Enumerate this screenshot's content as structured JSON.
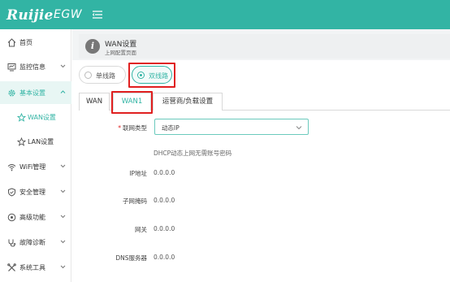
{
  "brand": {
    "logo_text": "Ruijie",
    "product": "EGW"
  },
  "sidebar": {
    "items": [
      {
        "label": "首页",
        "icon": "home-icon"
      },
      {
        "label": "监控信息",
        "icon": "monitor-icon"
      },
      {
        "label": "基本设置",
        "icon": "gear-icon"
      },
      {
        "label": "WAN设置",
        "icon": "star-icon"
      },
      {
        "label": "LAN设置",
        "icon": "star-icon"
      },
      {
        "label": "WiFi管理",
        "icon": "wifi-icon"
      },
      {
        "label": "安全管理",
        "icon": "shield-icon"
      },
      {
        "label": "高级功能",
        "icon": "advanced-icon"
      },
      {
        "label": "故障诊断",
        "icon": "diagnose-icon"
      },
      {
        "label": "系统工具",
        "icon": "tools-icon"
      }
    ]
  },
  "page": {
    "title": "WAN设置",
    "subtitle": "上网配置页面"
  },
  "mode": {
    "single": "单线路",
    "dual": "双线路",
    "selected": "dual"
  },
  "tabs": [
    {
      "label": "WAN"
    },
    {
      "label": "WAN1"
    },
    {
      "label": "运营商/负载设置"
    }
  ],
  "active_tab": "WAN1",
  "form": {
    "conn_type_label": "联网类型",
    "conn_type_value": "动态IP",
    "dhcp_hint": "DHCP动态上网无需账号密码",
    "ip_label": "IP地址",
    "ip_value": "0.0.0.0",
    "mask_label": "子网掩码",
    "mask_value": "0.0.0.0",
    "gateway_label": "网关",
    "gateway_value": "0.0.0.0",
    "dns_label": "DNS服务器",
    "dns_value": "0.0.0.0"
  },
  "colors": {
    "accent": "#32b4a4",
    "highlight": "#e02020",
    "topbar": "#32b4a4"
  }
}
